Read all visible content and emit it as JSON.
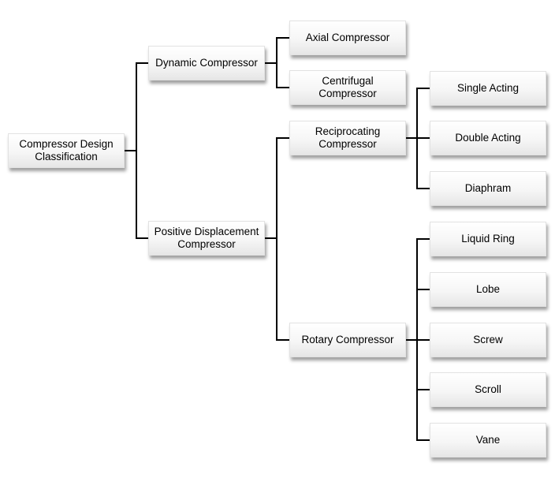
{
  "diagram": {
    "root": {
      "label": "Compressor Design\nClassification"
    },
    "dynamic": {
      "label": "Dynamic Compressor",
      "children": [
        {
          "label": "Axial Compressor"
        },
        {
          "label": "Centrifugal\nCompressor"
        }
      ]
    },
    "positive_displacement": {
      "label": "Positive Displacement\nCompressor",
      "reciprocating": {
        "label": "Reciprocating\nCompressor",
        "children": [
          {
            "label": "Single Acting"
          },
          {
            "label": "Double Acting"
          },
          {
            "label": "Diaphram"
          }
        ]
      },
      "rotary": {
        "label": "Rotary Compressor",
        "children": [
          {
            "label": "Liquid Ring"
          },
          {
            "label": "Lobe"
          },
          {
            "label": "Screw"
          },
          {
            "label": "Scroll"
          },
          {
            "label": "Vane"
          }
        ]
      }
    }
  }
}
